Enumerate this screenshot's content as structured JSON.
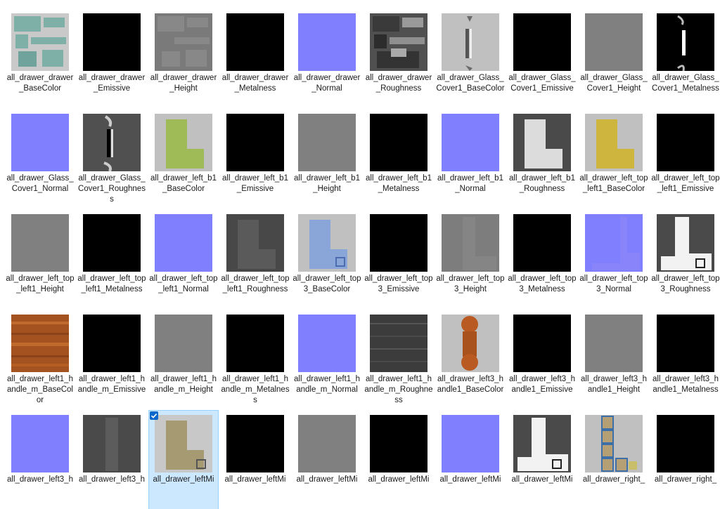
{
  "files": [
    {
      "name": "all_drawer_drawer_BaseColor",
      "thumb": "base-atlas-teal"
    },
    {
      "name": "all_drawer_drawer_Emissive",
      "thumb": "black"
    },
    {
      "name": "all_drawer_drawer_Height",
      "thumb": "height-atlas"
    },
    {
      "name": "all_drawer_drawer_Metalness",
      "thumb": "black"
    },
    {
      "name": "all_drawer_drawer_Normal",
      "thumb": "normal"
    },
    {
      "name": "all_drawer_drawer_Roughness",
      "thumb": "rough-atlas"
    },
    {
      "name": "all_drawer_Glass_Cover1_BaseColor",
      "thumb": "glass-base"
    },
    {
      "name": "all_drawer_Glass_Cover1_Emissive",
      "thumb": "black"
    },
    {
      "name": "all_drawer_Glass_Cover1_Height",
      "thumb": "gray"
    },
    {
      "name": "all_drawer_Glass_Cover1_Metalness",
      "thumb": "glass-metal"
    },
    {
      "name": "all_drawer_Glass_Cover1_Normal",
      "thumb": "normal"
    },
    {
      "name": "all_drawer_Glass_Cover1_Roughness",
      "thumb": "glass-rough"
    },
    {
      "name": "all_drawer_left_b1_BaseColor",
      "thumb": "T-green"
    },
    {
      "name": "all_drawer_left_b1_Emissive",
      "thumb": "black"
    },
    {
      "name": "all_drawer_left_b1_Height",
      "thumb": "gray"
    },
    {
      "name": "all_drawer_left_b1_Metalness",
      "thumb": "black"
    },
    {
      "name": "all_drawer_left_b1_Normal",
      "thumb": "normal"
    },
    {
      "name": "all_drawer_left_b1_Roughness",
      "thumb": "T-white"
    },
    {
      "name": "all_drawer_left_top_left1_BaseColor",
      "thumb": "T-yellow"
    },
    {
      "name": "all_drawer_left_top_left1_Emissive",
      "thumb": "black"
    },
    {
      "name": "all_drawer_left_top_left1_Height",
      "thumb": "gray"
    },
    {
      "name": "all_drawer_left_top_left1_Metalness",
      "thumb": "black"
    },
    {
      "name": "all_drawer_left_top_left1_Normal",
      "thumb": "normal"
    },
    {
      "name": "all_drawer_left_top_left1_Roughness",
      "thumb": "T-dark"
    },
    {
      "name": "all_drawer_left_top3_BaseColor",
      "thumb": "T-blue"
    },
    {
      "name": "all_drawer_left_top3_Emissive",
      "thumb": "black"
    },
    {
      "name": "all_drawer_left_top3_Height",
      "thumb": "gray-T"
    },
    {
      "name": "all_drawer_left_top3_Metalness",
      "thumb": "black"
    },
    {
      "name": "all_drawer_left_top3_Normal",
      "thumb": "normal-T"
    },
    {
      "name": "all_drawer_left_top3_Roughness",
      "thumb": "T-whiteblock"
    },
    {
      "name": "all_drawer_left1_handle_m_BaseColor",
      "thumb": "wood"
    },
    {
      "name": "all_drawer_left1_handle_m_Emissive",
      "thumb": "black"
    },
    {
      "name": "all_drawer_left1_handle_m_Height",
      "thumb": "gray"
    },
    {
      "name": "all_drawer_left1_handle_m_Metalness",
      "thumb": "black"
    },
    {
      "name": "all_drawer_left1_handle_m_Normal",
      "thumb": "normal"
    },
    {
      "name": "all_drawer_left1_handle_m_Roughness",
      "thumb": "dark-noise"
    },
    {
      "name": "all_drawer_left3_handle1_BaseColor",
      "thumb": "handle-base"
    },
    {
      "name": "all_drawer_left3_handle1_Emissive",
      "thumb": "black"
    },
    {
      "name": "all_drawer_left3_handle1_Height",
      "thumb": "gray"
    },
    {
      "name": "all_drawer_left3_handle1_Metalness",
      "thumb": "black"
    },
    {
      "name": "all_drawer_left3_h",
      "thumb": "normal"
    },
    {
      "name": "all_drawer_left3_h",
      "thumb": "dark-strip"
    },
    {
      "name": "all_drawer_leftMi",
      "thumb": "T-sandy",
      "selected": true
    },
    {
      "name": "all_drawer_leftMi",
      "thumb": "black"
    },
    {
      "name": "all_drawer_leftMi",
      "thumb": "gray"
    },
    {
      "name": "all_drawer_leftMi",
      "thumb": "black"
    },
    {
      "name": "all_drawer_leftMi",
      "thumb": "normal"
    },
    {
      "name": "all_drawer_leftMi",
      "thumb": "T-whiteblock"
    },
    {
      "name": "all_drawer_right_",
      "thumb": "right-tiles"
    },
    {
      "name": "all_drawer_right_",
      "thumb": "black"
    }
  ]
}
